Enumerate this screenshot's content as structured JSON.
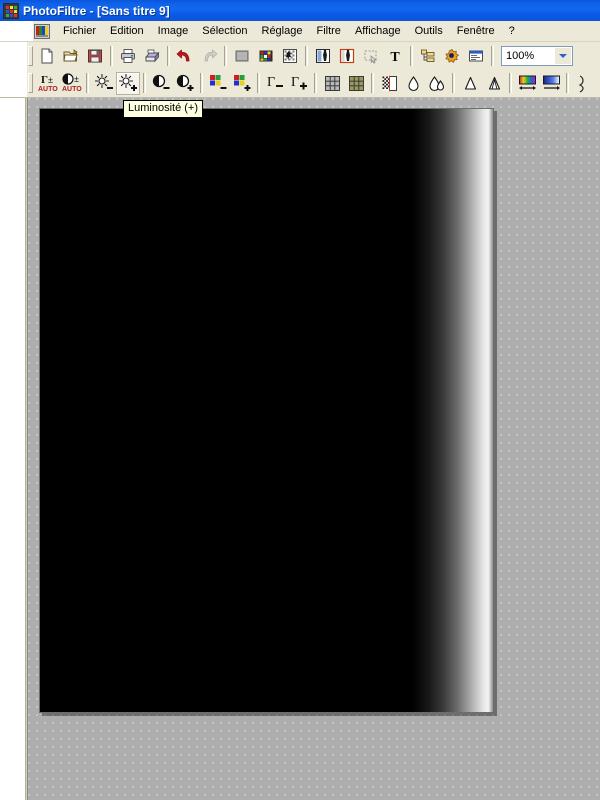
{
  "window": {
    "app_name": "PhotoFiltre",
    "separator": " - ",
    "document_title": "[Sans titre 9]",
    "full_title": "PhotoFiltre - [Sans titre 9]",
    "icon": "photofiltre-app-icon",
    "titlebar_color": "#0f62ec"
  },
  "menubar": {
    "document_icon": "mdi-document-icon",
    "items": [
      {
        "label": "Fichier",
        "name": "menu-fichier"
      },
      {
        "label": "Edition",
        "name": "menu-edition"
      },
      {
        "label": "Image",
        "name": "menu-image"
      },
      {
        "label": "Sélection",
        "name": "menu-selection"
      },
      {
        "label": "Réglage",
        "name": "menu-reglage"
      },
      {
        "label": "Filtre",
        "name": "menu-filtre"
      },
      {
        "label": "Affichage",
        "name": "menu-affichage"
      },
      {
        "label": "Outils",
        "name": "menu-outils"
      },
      {
        "label": "Fenêtre",
        "name": "menu-fenetre"
      },
      {
        "label": "?",
        "name": "menu-aide"
      }
    ]
  },
  "toolbar_main": {
    "buttons": [
      {
        "icon": "new-file-icon",
        "label": "Nouveau"
      },
      {
        "icon": "open-folder-icon",
        "label": "Ouvrir"
      },
      {
        "icon": "save-disk-icon",
        "label": "Enregistrer"
      },
      {
        "icon": "print-icon",
        "label": "Imprimer"
      },
      {
        "icon": "scanner-icon",
        "label": "Acquisition"
      },
      {
        "icon": "undo-arrow-icon",
        "label": "Annuler"
      },
      {
        "icon": "redo-arrow-icon",
        "label": "Refaire"
      },
      {
        "icon": "gray-swatch-icon",
        "label": "Couleur"
      },
      {
        "icon": "color-palette-icon",
        "label": "Palette de couleurs"
      },
      {
        "icon": "transparency-icon",
        "label": "Transparence"
      },
      {
        "icon": "image-copy-icon",
        "label": "Copier l'image"
      },
      {
        "icon": "image-paste-icon",
        "label": "Coller l'image"
      },
      {
        "icon": "selection-marquee-icon",
        "label": "Sélection"
      },
      {
        "icon": "text-tool-icon",
        "label": "Texte"
      },
      {
        "icon": "layers-icon",
        "label": "Calques"
      },
      {
        "icon": "effects-icon",
        "label": "Effets"
      },
      {
        "icon": "window-info-icon",
        "label": "Informations"
      }
    ],
    "zoom": {
      "value": "100%",
      "arrow": "chevron-down-icon"
    }
  },
  "toolbar_adjust": {
    "buttons": [
      {
        "icon": "gamma-auto-icon",
        "label": "Gamma auto",
        "glyph": "Γ±",
        "sub": "AUTO"
      },
      {
        "icon": "contrast-auto-icon",
        "label": "Contraste auto",
        "glyph": "◐±",
        "sub": "AUTO"
      },
      {
        "icon": "brightness-minus-icon",
        "label": "Luminosité (-)"
      },
      {
        "icon": "brightness-plus-icon",
        "label": "Luminosité (+)",
        "state": "hover"
      },
      {
        "icon": "contrast-minus-icon",
        "label": "Contraste (-)"
      },
      {
        "icon": "contrast-plus-icon",
        "label": "Contraste (+)"
      },
      {
        "icon": "saturation-minus-icon",
        "label": "Saturation (-)"
      },
      {
        "icon": "saturation-plus-icon",
        "label": "Saturation (+)"
      },
      {
        "icon": "gamma-minus-icon",
        "label": "Gamma (-)",
        "glyph": "Γ–"
      },
      {
        "icon": "gamma-plus-icon",
        "label": "Gamma (+)",
        "glyph": "Γ+"
      },
      {
        "icon": "dither-gray-icon",
        "label": "Trame"
      },
      {
        "icon": "dither-color-icon",
        "label": "Trame couleur"
      },
      {
        "icon": "halftone-icon",
        "label": "Demi-teinte"
      },
      {
        "icon": "blur-drop-icon",
        "label": "Flou"
      },
      {
        "icon": "blur-more-icon",
        "label": "Flou renforcé"
      },
      {
        "icon": "sharpen-icon",
        "label": "Netteté"
      },
      {
        "icon": "sharpen-more-icon",
        "label": "Netteté renforcée"
      },
      {
        "icon": "gradient-rainbow-icon",
        "label": "Dégradé"
      },
      {
        "icon": "gradient-blue-icon",
        "label": "Dégradé bichrome"
      },
      {
        "icon": "edge-icon",
        "label": "Contours"
      }
    ]
  },
  "tooltip": {
    "text": "Luminosité (+)"
  },
  "image_window": {
    "name": "document-canvas",
    "title": "Sans titre 9",
    "zoom_level": "100%",
    "canvas_description": "black image with white gradient on right edge"
  }
}
